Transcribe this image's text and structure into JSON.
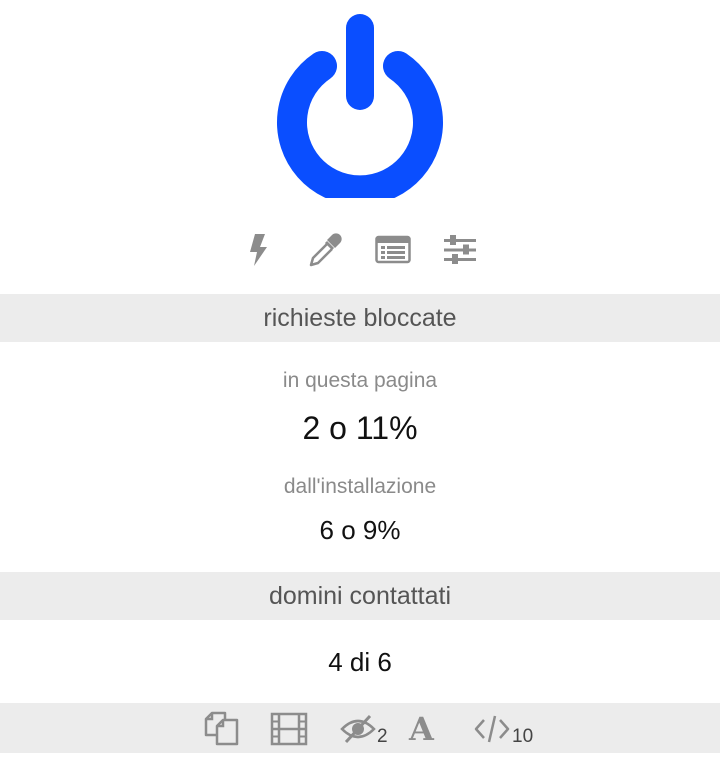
{
  "colors": {
    "power": "#0a4eff",
    "icon": "#8c8c8c",
    "band": "#ececec"
  },
  "toolbar": {
    "icons": [
      "lightning-icon",
      "eyedropper-icon",
      "logger-icon",
      "settings-sliders-icon"
    ]
  },
  "sections": {
    "blocked_header": "richieste bloccate",
    "this_page_label": "in questa pagina",
    "this_page_value": "2 o 11%",
    "since_install_label": "dall'installazione",
    "since_install_value": "6 o 9%",
    "domains_header": "domini contattati",
    "domains_value": "4 di 6"
  },
  "bottom_tools": {
    "icons": [
      "popups-icon",
      "media-icon",
      "cosmetic-filter-icon",
      "fonts-icon",
      "scripts-icon"
    ],
    "cosmetic_count": "2",
    "scripts_count": "10"
  }
}
